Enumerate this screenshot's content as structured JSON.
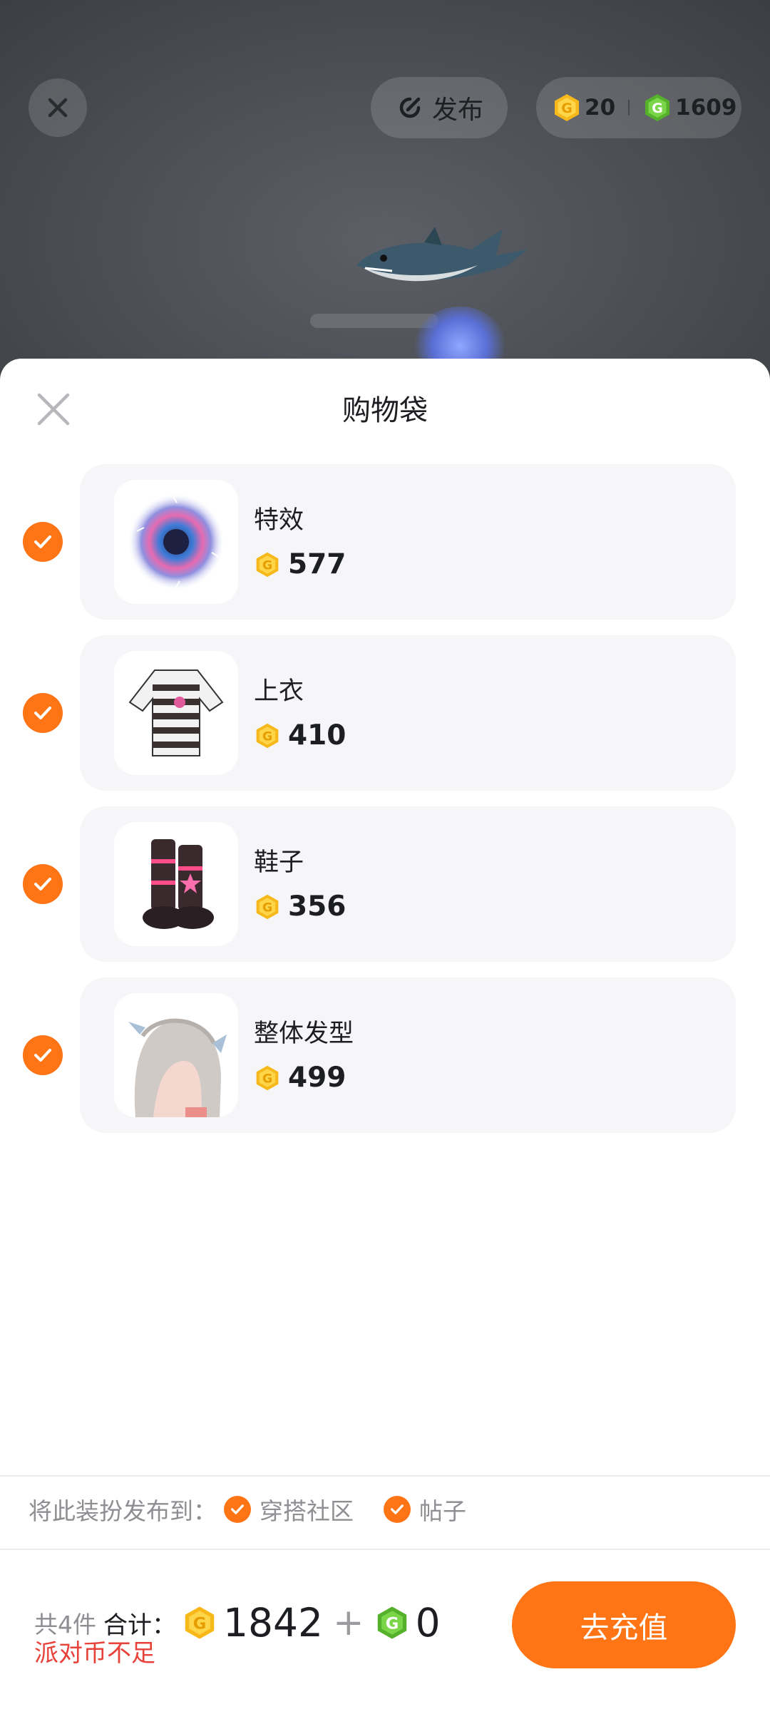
{
  "top_bar": {
    "publish_label": "发布",
    "currency": {
      "gold_value": "20",
      "green_value": "1609"
    }
  },
  "sheet": {
    "title": "购物袋",
    "items": [
      {
        "name": "特效",
        "price": "577",
        "checked": true
      },
      {
        "name": "上衣",
        "price": "410",
        "checked": true
      },
      {
        "name": "鞋子",
        "price": "356",
        "checked": true
      },
      {
        "name": "整体发型",
        "price": "499",
        "checked": true
      }
    ],
    "publish_to": {
      "label": "将此装扮发布到：",
      "options": [
        {
          "label": "穿搭社区",
          "checked": true
        },
        {
          "label": "帖子",
          "checked": true
        }
      ]
    },
    "footer": {
      "count_text": "共4件",
      "total_label": "合计：",
      "gold_total": "1842",
      "plus": "+",
      "green_total": "0",
      "warning": "派对币不足",
      "recharge_label": "去充值"
    }
  },
  "colors": {
    "accent": "#ff7415",
    "warning": "#e8413a",
    "gold_coin": "#f6b81a",
    "green_coin": "#6cc53a"
  },
  "icons": [
    "close-icon",
    "publish-icon",
    "gold-coin-icon",
    "green-coin-icon",
    "check-icon"
  ]
}
